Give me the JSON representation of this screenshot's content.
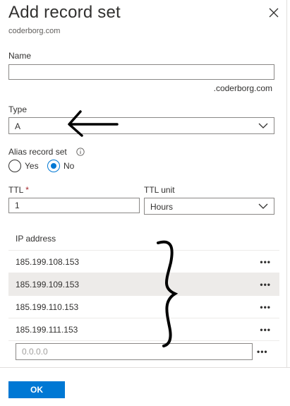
{
  "header": {
    "title": "Add record set",
    "subtitle": "coderborg.com",
    "close_icon": "close-icon"
  },
  "form": {
    "name": {
      "label": "Name",
      "value": "",
      "suffix": ".coderborg.com"
    },
    "type": {
      "label": "Type",
      "value": "A"
    },
    "alias": {
      "label": "Alias record set",
      "options": [
        "Yes",
        "No"
      ],
      "selected": "No"
    },
    "ttl": {
      "label": "TTL",
      "required_marker": "*",
      "value": "1"
    },
    "ttl_unit": {
      "label": "TTL unit",
      "value": "Hours"
    }
  },
  "grid": {
    "header": "IP address",
    "rows": [
      "185.199.108.153",
      "185.199.109.153",
      "185.199.110.153",
      "185.199.111.153"
    ],
    "selected_row": 1,
    "more_label": "•••",
    "new_placeholder": "0.0.0.0"
  },
  "footer": {
    "ok_label": "OK"
  },
  "colors": {
    "accent": "#0078d4",
    "border": "#8a8886",
    "required": "#a4262c",
    "selected_row": "#edebe9"
  }
}
